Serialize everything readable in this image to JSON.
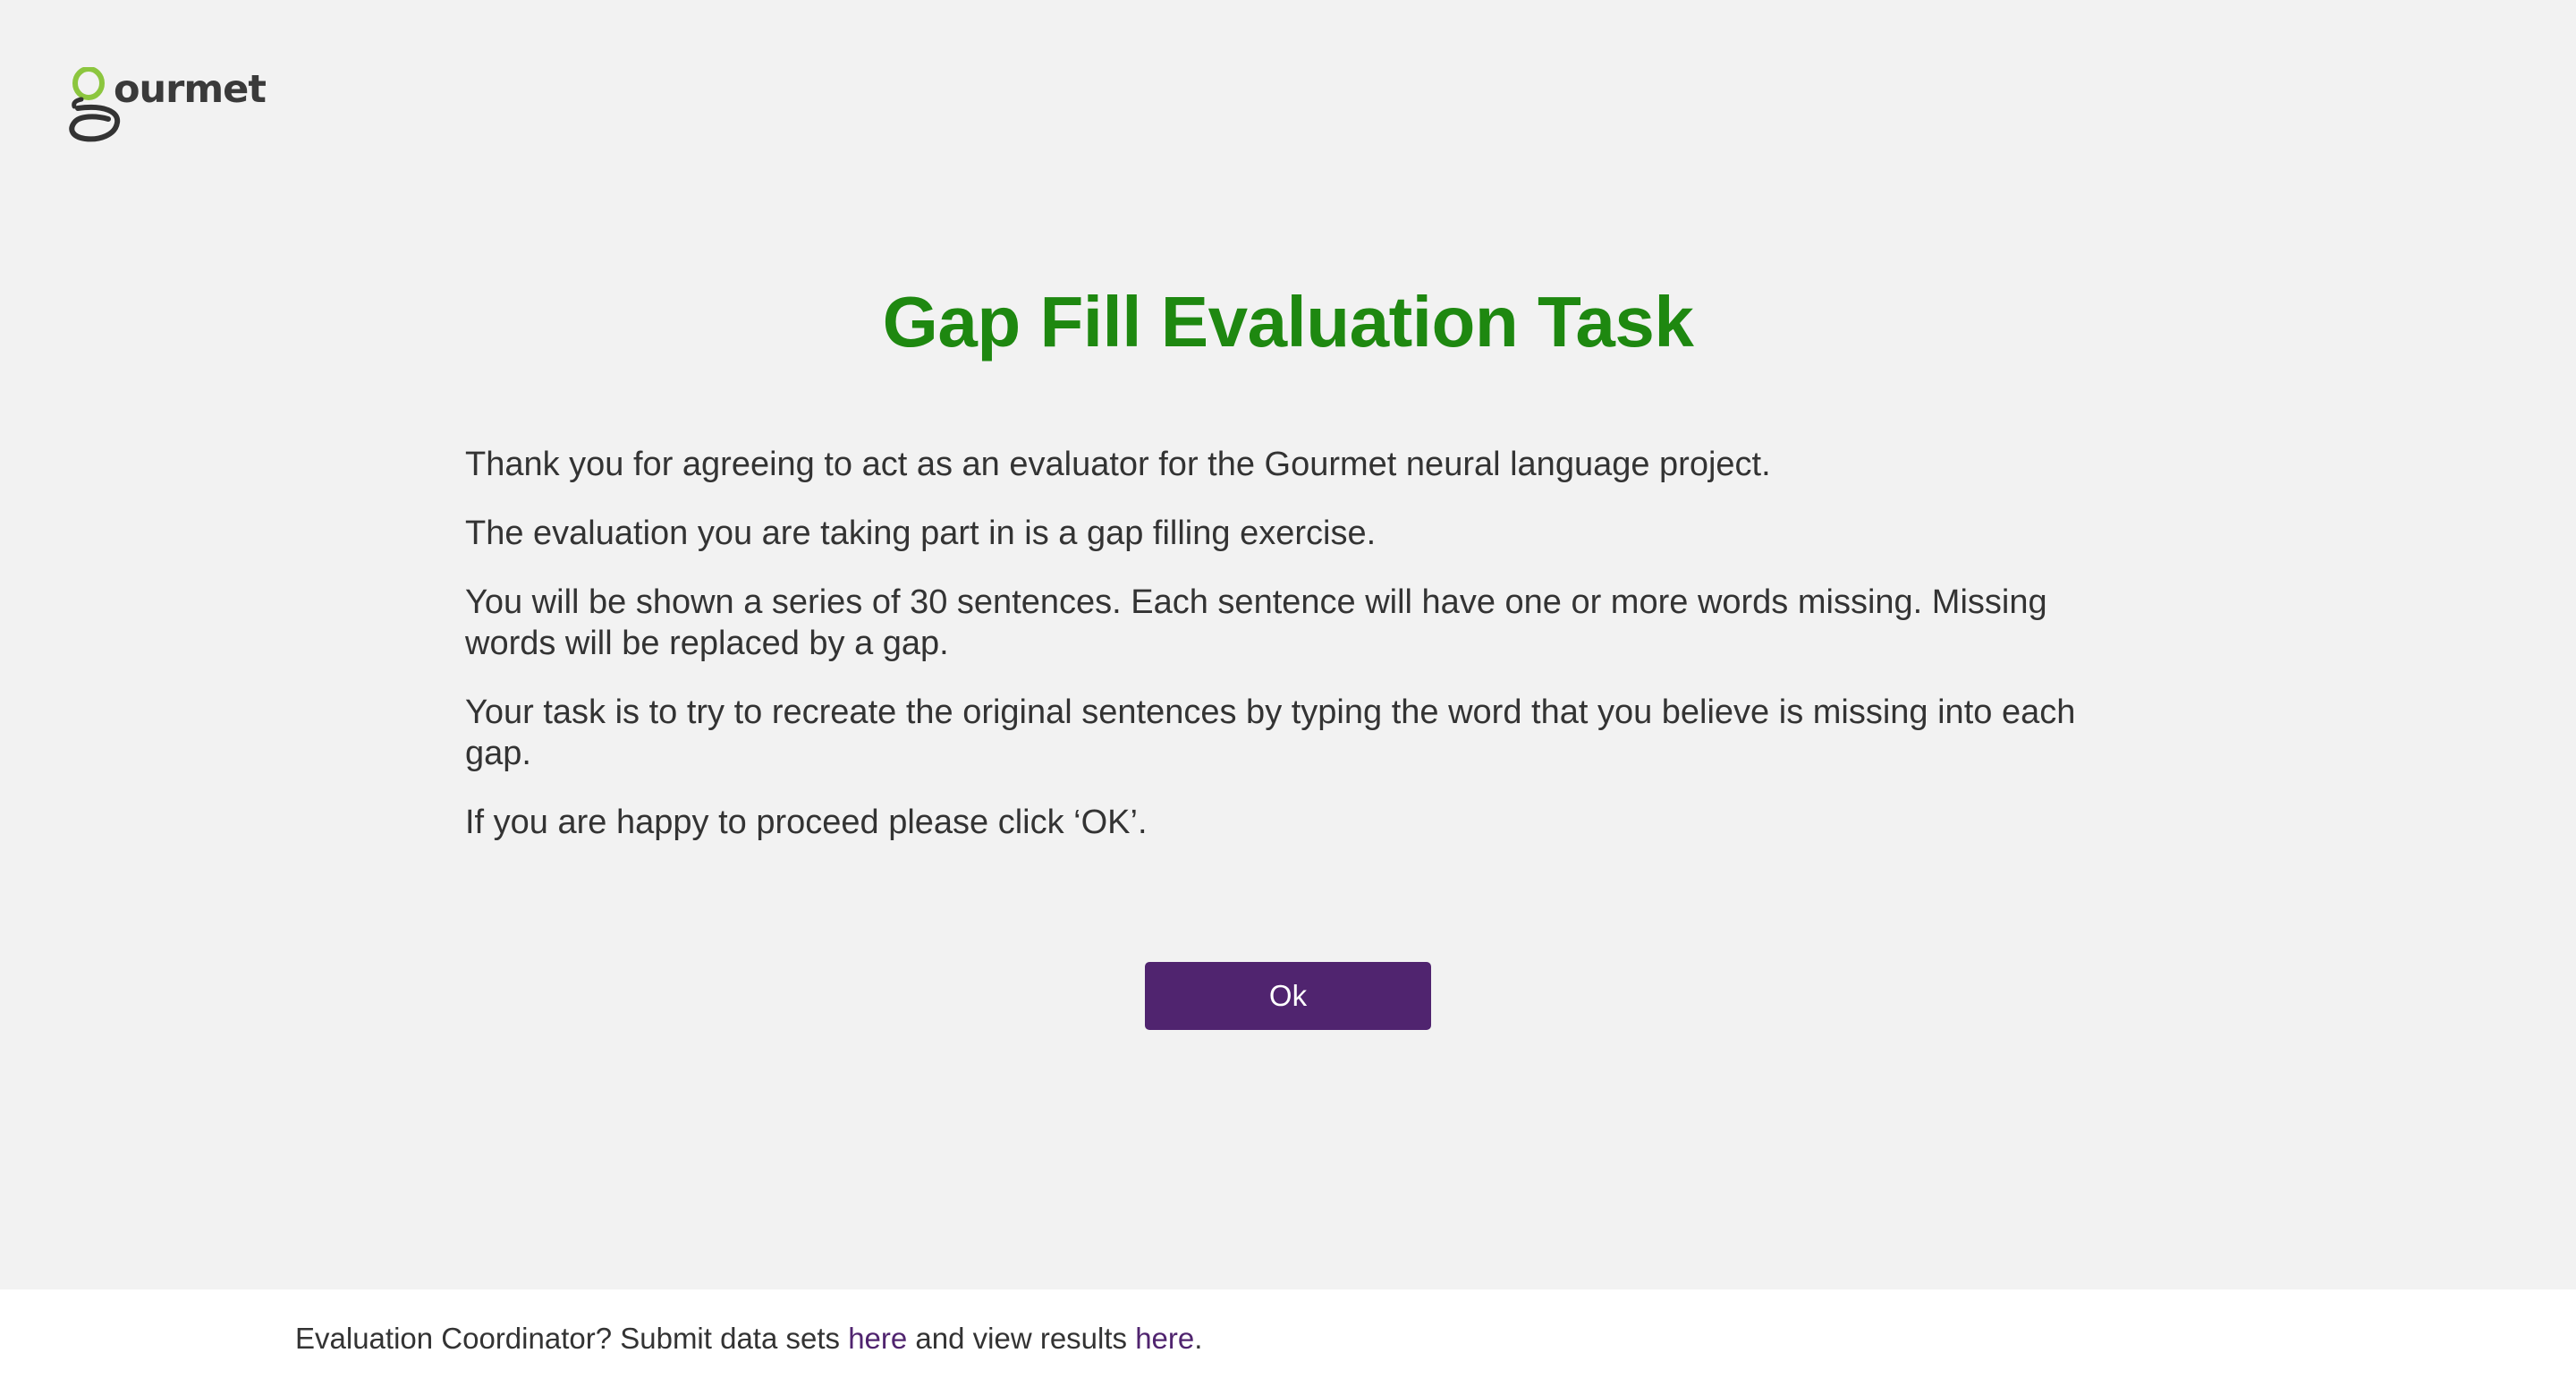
{
  "header": {
    "logo_text": "gourmet",
    "logo_icon": "gourmet-g-logo-icon",
    "logo_accent_color": "#8cc63f"
  },
  "main": {
    "title": "Gap Fill Evaluation Task",
    "paragraphs": [
      "Thank you for agreeing to act as an evaluator for the Gourmet neural language project.",
      "The evaluation you are taking part in is a gap filling exercise.",
      "You will be shown a series of 30 sentences. Each sentence will have one or more words missing. Missing words will be replaced by a gap.",
      "Your task is to try to recreate the original sentences by typing the word that you believe is missing into each gap.",
      "If you are happy to proceed please click ‘OK’."
    ],
    "ok_label": "Ok"
  },
  "footer": {
    "text_before": "Evaluation Coordinator? Submit data sets ",
    "link1": "here",
    "text_middle": " and view results ",
    "link2": "here",
    "text_after": "."
  },
  "colors": {
    "title": "#1e8810",
    "button": "#50246f",
    "link": "#50246f",
    "background": "#f2f2f2",
    "footer_background": "#ffffff"
  }
}
